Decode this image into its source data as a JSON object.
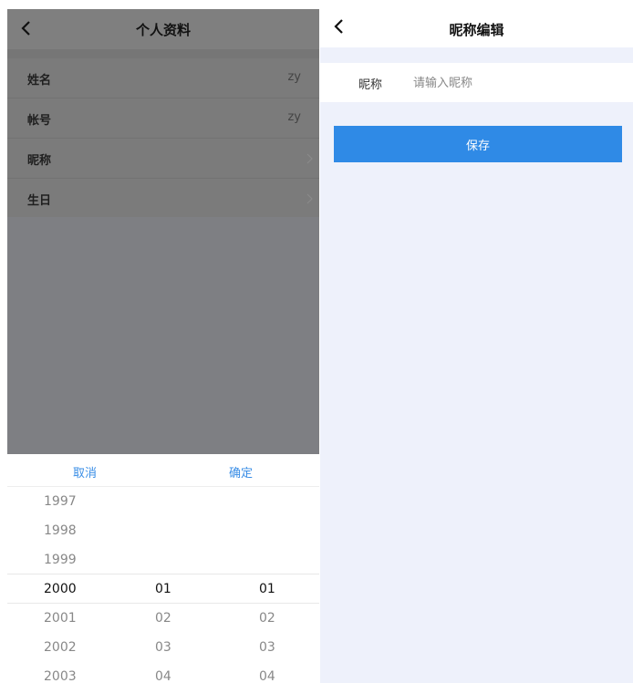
{
  "left": {
    "title": "个人资料",
    "rows": [
      {
        "label": "姓名",
        "value": "zy"
      },
      {
        "label": "帐号",
        "value": "zy"
      },
      {
        "label": "昵称",
        "value": ""
      },
      {
        "label": "生日",
        "value": ""
      }
    ],
    "picker": {
      "cancel_label": "取消",
      "confirm_label": "确定",
      "years": [
        "1997",
        "1998",
        "1999",
        "2000",
        "2001",
        "2002",
        "2003"
      ],
      "months": [
        "01",
        "02",
        "03",
        "04"
      ],
      "days": [
        "01",
        "02",
        "03",
        "04"
      ],
      "selected": {
        "year": "2000",
        "month": "01",
        "day": "01"
      }
    }
  },
  "right": {
    "title": "昵称编辑",
    "field_label": "昵称",
    "input_placeholder": "请输入昵称",
    "input_value": "",
    "save_label": "保存",
    "accent_color": "#2f8ae6",
    "background_color": "#eef1fb"
  },
  "icons": {
    "back": "chevron-left-icon",
    "row_arrow": "chevron-right-icon"
  }
}
